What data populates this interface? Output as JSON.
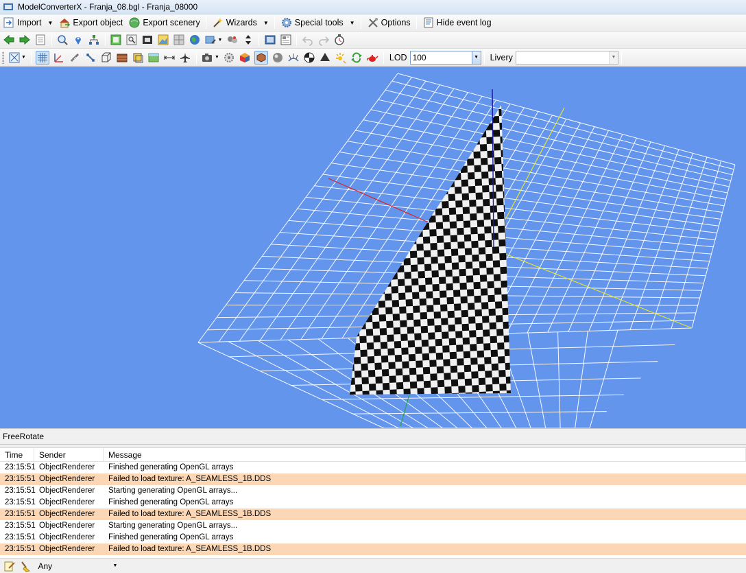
{
  "window": {
    "title": "ModelConverterX - Franja_08.bgl - Franja_08000"
  },
  "menubar": {
    "import_label": "Import",
    "export_object_label": "Export object",
    "export_scenery_label": "Export scenery",
    "wizards_label": "Wizards",
    "special_tools_label": "Special tools",
    "options_label": "Options",
    "hide_event_log_label": "Hide event log"
  },
  "render_toolbar": {
    "lod_label": "LOD",
    "lod_value": "100",
    "livery_label": "Livery",
    "livery_value": ""
  },
  "viewport": {
    "mode_label": "FreeRotate",
    "background_color": "#6495ed"
  },
  "event_log": {
    "columns": [
      "Time",
      "Sender",
      "Message"
    ],
    "rows": [
      {
        "time": "23:15:51",
        "sender": "ObjectRenderer",
        "message": "Finished generating OpenGL arrays",
        "level": "info"
      },
      {
        "time": "23:15:51",
        "sender": "ObjectRenderer",
        "message": "Failed to load texture: A_SEAMLESS_1B.DDS",
        "level": "error"
      },
      {
        "time": "23:15:51",
        "sender": "ObjectRenderer",
        "message": "Starting generating OpenGL arrays...",
        "level": "info"
      },
      {
        "time": "23:15:51",
        "sender": "ObjectRenderer",
        "message": "Finished generating OpenGL arrays",
        "level": "info"
      },
      {
        "time": "23:15:51",
        "sender": "ObjectRenderer",
        "message": "Failed to load texture: A_SEAMLESS_1B.DDS",
        "level": "error"
      },
      {
        "time": "23:15:51",
        "sender": "ObjectRenderer",
        "message": "Starting generating OpenGL arrays...",
        "level": "info"
      },
      {
        "time": "23:15:51",
        "sender": "ObjectRenderer",
        "message": "Finished generating OpenGL arrays",
        "level": "info"
      },
      {
        "time": "23:15:51",
        "sender": "ObjectRenderer",
        "message": "Failed to load texture: A_SEAMLESS_1B.DDS",
        "level": "error"
      }
    ]
  },
  "statusbar": {
    "filter_value": "Any"
  },
  "colors": {
    "error_row": "#fcd7b5",
    "viewport_bg": "#6495ed",
    "x_axis": "#e02020",
    "y_axis": "#e6e62a",
    "z_axis": "#1a1aa0"
  }
}
